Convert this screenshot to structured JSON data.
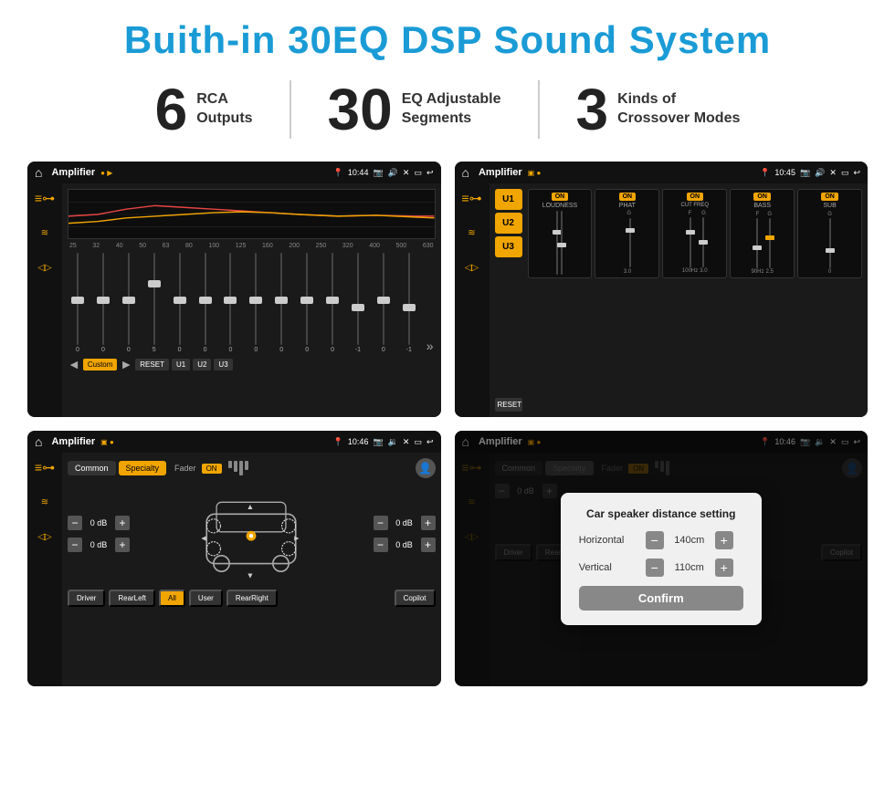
{
  "title": "Buith-in 30EQ DSP Sound System",
  "stats": [
    {
      "number": "6",
      "line1": "RCA",
      "line2": "Outputs"
    },
    {
      "number": "30",
      "line1": "EQ Adjustable",
      "line2": "Segments"
    },
    {
      "number": "3",
      "line1": "Kinds of",
      "line2": "Crossover Modes"
    }
  ],
  "screens": {
    "eq_screen": {
      "status": {
        "title": "Amplifier",
        "time": "10:44"
      },
      "eq_labels": [
        "25",
        "32",
        "40",
        "50",
        "63",
        "80",
        "100",
        "125",
        "160",
        "200",
        "250",
        "320",
        "400",
        "500",
        "630"
      ],
      "eq_values": [
        "0",
        "0",
        "0",
        "5",
        "0",
        "0",
        "0",
        "0",
        "0",
        "0",
        "0",
        "-1",
        "0",
        "-1"
      ],
      "buttons": [
        "Custom",
        "RESET",
        "U1",
        "U2",
        "U3"
      ]
    },
    "amp_screen": {
      "status": {
        "title": "Amplifier",
        "time": "10:45"
      },
      "u_labels": [
        "U1",
        "U2",
        "U3"
      ],
      "channels": [
        "LOUDNESS",
        "PHAT",
        "CUT FREQ",
        "BASS",
        "SUB"
      ],
      "reset_label": "RESET"
    },
    "cross_screen": {
      "status": {
        "title": "Amplifier",
        "time": "10:46"
      },
      "tabs": [
        "Common",
        "Specialty"
      ],
      "fader_label": "Fader",
      "on_label": "ON",
      "values": [
        "0 dB",
        "0 dB",
        "0 dB",
        "0 dB"
      ],
      "bottom_buttons": [
        "Driver",
        "RearLeft",
        "All",
        "User",
        "RearRight",
        "Copilot"
      ]
    },
    "dialog_screen": {
      "status": {
        "title": "Amplifier",
        "time": "10:46"
      },
      "dialog": {
        "title": "Car speaker distance setting",
        "horizontal_label": "Horizontal",
        "horizontal_value": "140cm",
        "vertical_label": "Vertical",
        "vertical_value": "110cm",
        "confirm_label": "Confirm"
      }
    }
  }
}
